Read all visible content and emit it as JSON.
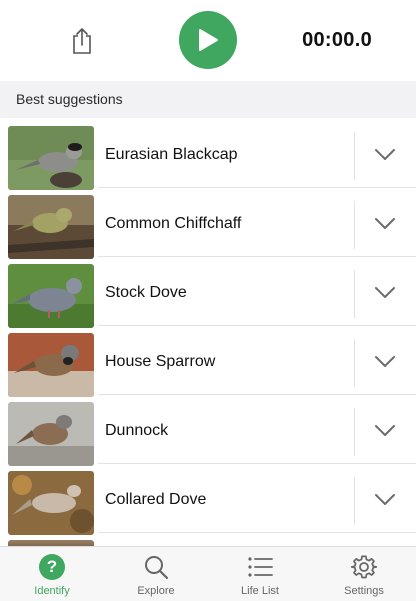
{
  "header": {
    "timer": "00:00.0",
    "share_icon": "share-icon",
    "play_icon": "play-icon",
    "accent_color": "#3fa75f"
  },
  "suggestions": {
    "title": "Best suggestions",
    "items": [
      {
        "name": "Eurasian Blackcap"
      },
      {
        "name": "Common Chiffchaff"
      },
      {
        "name": "Stock Dove"
      },
      {
        "name": "House Sparrow"
      },
      {
        "name": "Dunnock"
      },
      {
        "name": "Collared Dove"
      }
    ]
  },
  "tabbar": {
    "tabs": [
      {
        "label": "Identify",
        "icon": "question-mark-icon",
        "active": true
      },
      {
        "label": "Explore",
        "icon": "search-icon",
        "active": false
      },
      {
        "label": "Life List",
        "icon": "list-icon",
        "active": false
      },
      {
        "label": "Settings",
        "icon": "gear-icon",
        "active": false
      }
    ]
  }
}
